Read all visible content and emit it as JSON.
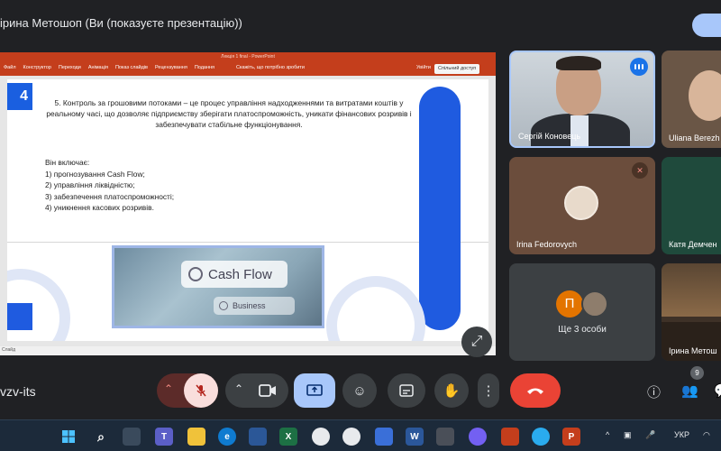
{
  "header": {
    "presenter_title": "ірина Метошоп (Ви (показуєте презентацію))"
  },
  "powerpoint": {
    "doc_title": "Лекція 1 final - PowerPoint",
    "tabs": [
      "Файл",
      "Конструктор",
      "Переходи",
      "Анімація",
      "Показ слайдів",
      "Рецензування",
      "Подання"
    ],
    "tell_me": "Скажіть, що потрібно зробити",
    "sign_in": "Увійти",
    "share": "Спільний доступ",
    "status_text": "Слайд"
  },
  "slide": {
    "number": "4",
    "paragraph": "5. Контроль за грошовими потоками – це процес управління надходженнями та витратами коштів у реальному часі, що дозволяє підприємству зберігати платоспроможність, уникати фінансових розривів і забезпечувати стабільне функціонування.",
    "list_heading": "Він включає:",
    "list_items": [
      "1) прогнозування Cash Flow;",
      "2) управління ліквідністю;",
      "3) забезпечення платоспроможності;",
      "4) уникнення касових розривів."
    ],
    "image_label_main": "Cash Flow",
    "image_label_sub": "Business"
  },
  "participants": [
    {
      "name": "Сергій Коновець",
      "speaking": true
    },
    {
      "name": "Uliana Berezh",
      "speaking": false
    },
    {
      "name": "Irina Fedorovych",
      "muted": true
    },
    {
      "name": "Катя Демчен",
      "muted": false
    },
    {
      "name": "Ще 3 особи",
      "initial": "П"
    },
    {
      "name": "Ірина Метош",
      "muted": false
    }
  ],
  "controls": {
    "meeting_code": "vzv-its",
    "people_count": "9",
    "icons": [
      "chevron-up",
      "mic-off",
      "chevron-up",
      "camera",
      "present",
      "emoji",
      "captions",
      "hand",
      "more",
      "end-call",
      "info",
      "people",
      "chat"
    ]
  },
  "taskbar": {
    "language": "УКР",
    "notification_count": "1"
  },
  "colors": {
    "meet_bg": "#202124",
    "ppt_accent": "#c43e1c",
    "slide_blue": "#1f5be0",
    "end_call": "#ea4335",
    "present_active": "#a8c7fa"
  }
}
